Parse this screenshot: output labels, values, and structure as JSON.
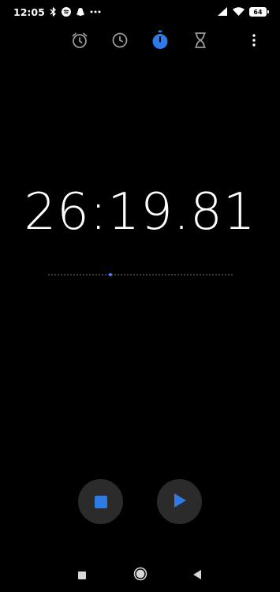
{
  "status_bar": {
    "time": "12:05",
    "battery_level": "64",
    "icons": [
      "bluetooth-icon",
      "spotify-icon",
      "snapchat-icon",
      "more-notifications-icon",
      "signal-icon",
      "wifi-icon",
      "battery-icon"
    ]
  },
  "tabs": [
    {
      "name": "alarm",
      "icon": "alarm-icon",
      "active": false
    },
    {
      "name": "clock",
      "icon": "clock-icon",
      "active": false
    },
    {
      "name": "stopwatch",
      "icon": "stopwatch-icon",
      "active": true
    },
    {
      "name": "timer",
      "icon": "hourglass-icon",
      "active": false
    }
  ],
  "stopwatch": {
    "elapsed": "26:19.81",
    "progress_fraction": 0.34
  },
  "controls": {
    "stop": "stop-icon",
    "play": "play-icon"
  },
  "colors": {
    "background": "#000000",
    "accent": "#2f7ae5",
    "button_bg": "#2b2b2b",
    "inactive_icon": "#9a9a9a"
  },
  "nav": [
    "recent-apps-icon",
    "home-icon",
    "back-icon"
  ]
}
